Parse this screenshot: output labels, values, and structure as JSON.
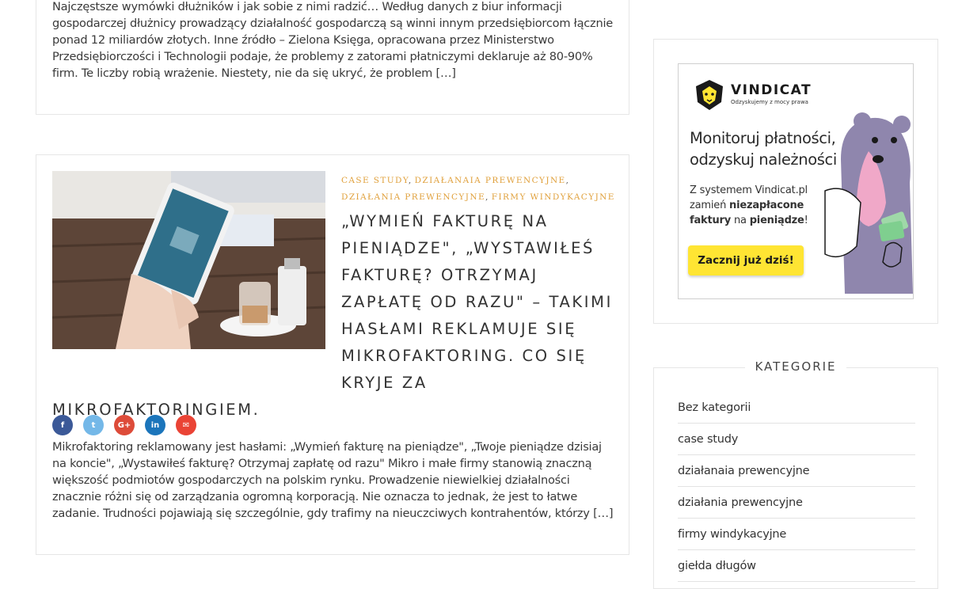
{
  "post1": {
    "excerpt": "Najczęstsze wymówki dłużników i jak sobie z nimi radzić… Według danych z biur informacji gospodarczej dłużnicy prowadzący działalność gospodarczą są winni innym przedsiębiorcom łącznie ponad 12 miliardów złotych. Inne źródło – Zielona Księga, opracowana przez Ministerstwo Przedsiębiorczości i Technologii podaje, że problemy z zatorami płatniczymi deklaruje aż 80-90% firm. Te liczby robią wrażenie. Niestety, nie da się ukryć, że problem […]"
  },
  "post2": {
    "categories": [
      "Case study",
      "Działanaia prewencyjne",
      "Działania prewencyjne",
      "Firmy windykacyjne"
    ],
    "title": "„Wymień fakturę na pieniądze\", „Wystawiłeś fakturę? Otrzymaj zapłatę od razu\" – takimi hasłami reklamuje się mikrofaktoring. Co się kryje za mikrofaktoringiem.",
    "share": [
      {
        "icon": "facebook-icon",
        "glyph": "f",
        "color": "#3b5998"
      },
      {
        "icon": "twitter-icon",
        "glyph": "t",
        "color": "#74b8e8"
      },
      {
        "icon": "google-plus-icon",
        "glyph": "G+",
        "color": "#dd4b39"
      },
      {
        "icon": "linkedin-icon",
        "glyph": "in",
        "color": "#1b75bb"
      },
      {
        "icon": "email-icon",
        "glyph": "✉",
        "color": "#ea4335"
      }
    ],
    "excerpt": "Mikrofaktoring reklamowany jest hasłami: „Wymień fakturę na pieniądze\", „Twoje pieniądze dzisiaj na koncie\", „Wystawiłeś fakturę? Otrzymaj zapłatę od razu\" Mikro i małe firmy stanowią znaczną większość podmiotów gospodarczych na polskim rynku. Prowadzenie niewielkiej działalności znacznie różni się od zarządzania ogromną korporacją. Nie oznacza to jednak, że jest to łatwe zadanie. Trudności pojawiają się szczególnie, gdy trafimy na nieuczciwych kontrahentów, którzy […]"
  },
  "ad": {
    "brand": "VINDICAT",
    "tagline": "Odzyskujemy z mocy prawa",
    "headline_line1": "Monitoruj płatności,",
    "headline_line2": "odzyskuj należności",
    "body_line1": "Z systemem Vindicat.pl",
    "body_line2_a": "zamień ",
    "body_line2_b": "niezapłacone",
    "body_line3_a": "faktury",
    "body_line3_b": " na ",
    "body_line3_c": "pieniądze",
    "body_line3_d": "!",
    "cta": "Zacznij już dziś!",
    "accent": "#ffe533"
  },
  "sidebar": {
    "categories_heading": "KATEGORIE",
    "categories": [
      "Bez kategorii",
      "case study",
      "działanaia prewencyjne",
      "działania prewencyjne",
      "firmy windykacyjne",
      "giełda długów"
    ]
  }
}
